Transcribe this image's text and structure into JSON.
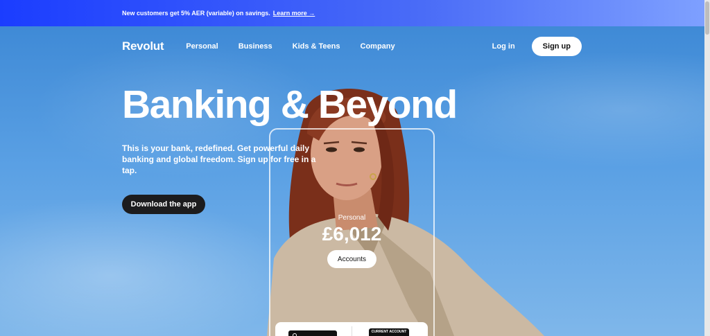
{
  "banner": {
    "text": "New customers get 5% AER (variable) on savings.",
    "link": "Learn more →"
  },
  "nav": {
    "logo": "Revolut",
    "items": [
      "Personal",
      "Business",
      "Kids & Teens",
      "Company"
    ],
    "login": "Log in",
    "signup": "Sign up"
  },
  "hero": {
    "headline": "Banking & Beyond",
    "subtext": "This is your bank, redefined. Get powerful daily banking and global freedom. Sign up for free in a tap.",
    "cta": "Download the app"
  },
  "phone": {
    "account_label": "Personal",
    "balance": "£6,012",
    "accounts_button": "Accounts",
    "card_label": "CURRENT ACCOUNT"
  },
  "colors": {
    "banner_start": "#1b3dff",
    "sky": "#4a8fd8",
    "cta_bg": "#1c1c1e"
  }
}
